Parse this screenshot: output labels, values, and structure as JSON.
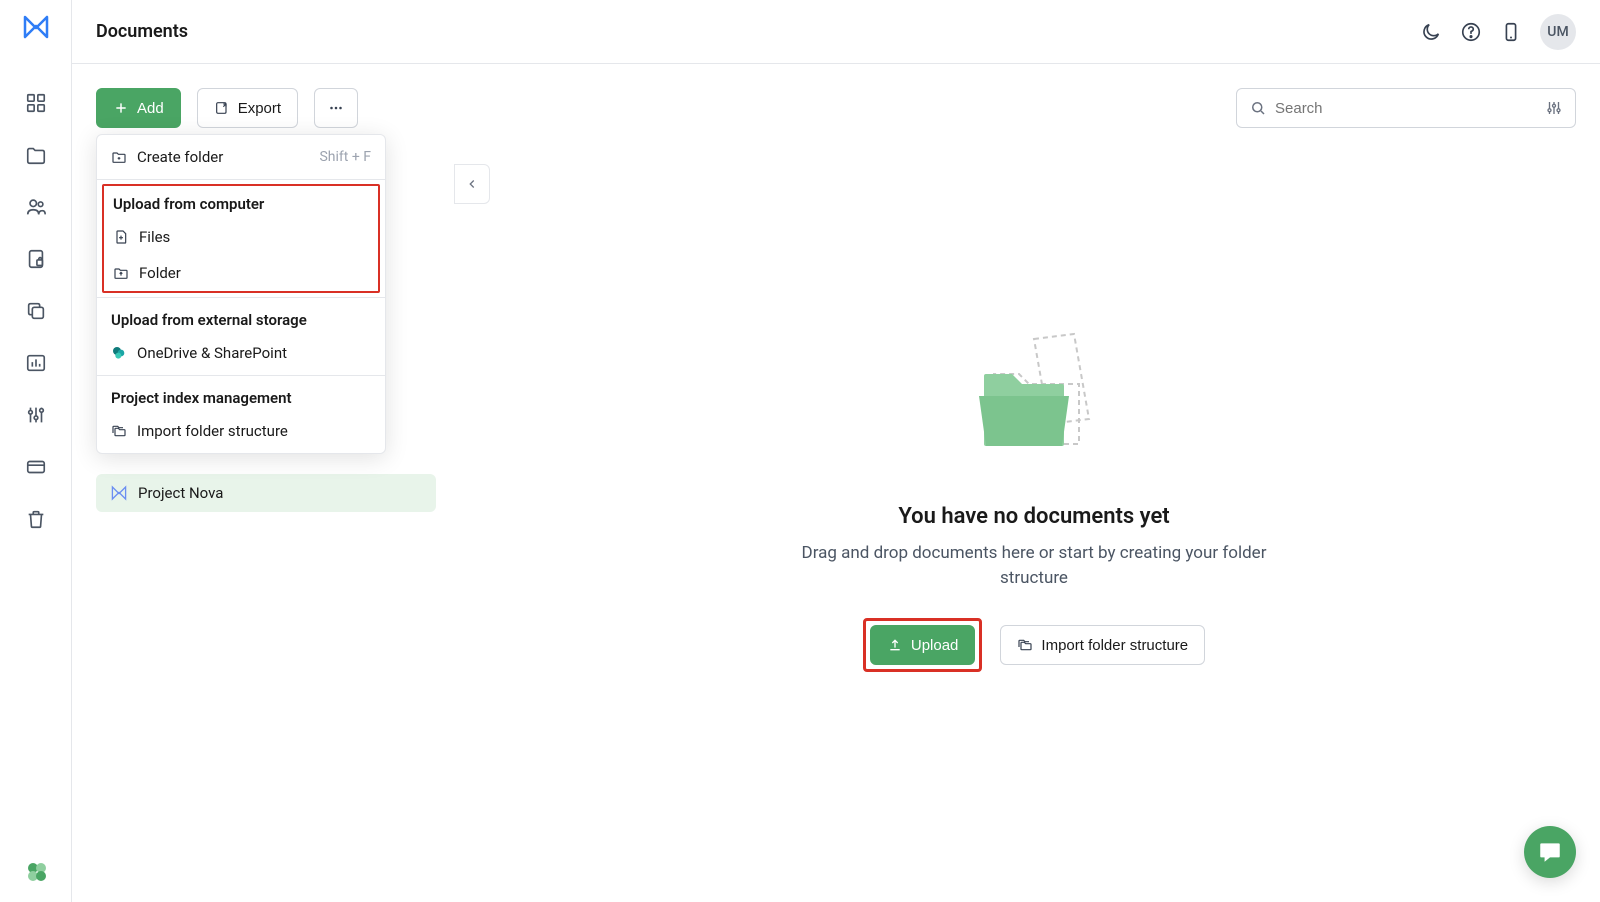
{
  "header": {
    "title": "Documents",
    "avatar_initials": "UM"
  },
  "toolbar": {
    "add_label": "Add",
    "export_label": "Export",
    "search_placeholder": "Search"
  },
  "dropdown": {
    "create_folder_label": "Create folder",
    "create_folder_shortcut": "Shift + F",
    "upload_computer_heading": "Upload from computer",
    "files_label": "Files",
    "folder_label": "Folder",
    "external_heading": "Upload from external storage",
    "onedrive_label": "OneDrive & SharePoint",
    "index_heading": "Project index management",
    "import_structure_label": "Import folder structure"
  },
  "tree": {
    "active_project": "Project Nova"
  },
  "empty_state": {
    "title": "You have no documents yet",
    "subtitle": "Drag and drop documents here or start by creating your folder structure",
    "upload_label": "Upload",
    "import_label": "Import folder structure"
  },
  "sidebar_icons": [
    "dashboard-icon",
    "documents-icon",
    "people-icon",
    "secure-doc-icon",
    "copy-icon",
    "chart-icon",
    "sliders-icon",
    "card-icon",
    "trash-icon"
  ],
  "colors": {
    "primary_green": "#4aa564",
    "highlight_red": "#d93025"
  }
}
